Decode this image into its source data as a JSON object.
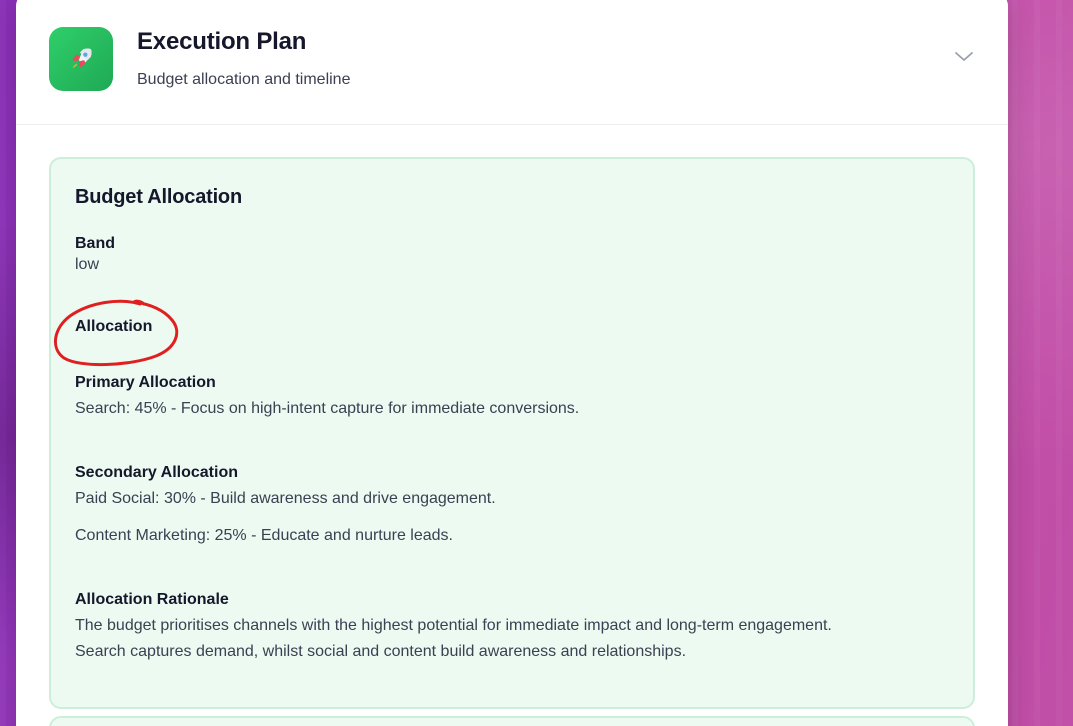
{
  "header": {
    "icon": "rocket-icon",
    "title": "Execution Plan",
    "subtitle": "Budget allocation and timeline"
  },
  "budget": {
    "title": "Budget Allocation",
    "band_label": "Band",
    "band_value": "low",
    "allocation_label": "Allocation",
    "primary_label": "Primary Allocation",
    "primary_items": [
      "Search: 45% - Focus on high-intent capture for immediate conversions."
    ],
    "secondary_label": "Secondary Allocation",
    "secondary_items": [
      "Paid Social: 30% - Build awareness and drive engagement.",
      "Content Marketing: 25% - Educate and nurture leads."
    ],
    "rationale_label": "Allocation Rationale",
    "rationale_lines": [
      "The budget prioritises channels with the highest potential for immediate impact and long-term engagement.",
      "Search captures demand, whilst social and content build awareness and relationships."
    ]
  },
  "colors": {
    "app_icon": "#22c15e",
    "card_bg": "#ecfaf1",
    "annotation": "#e02020"
  }
}
